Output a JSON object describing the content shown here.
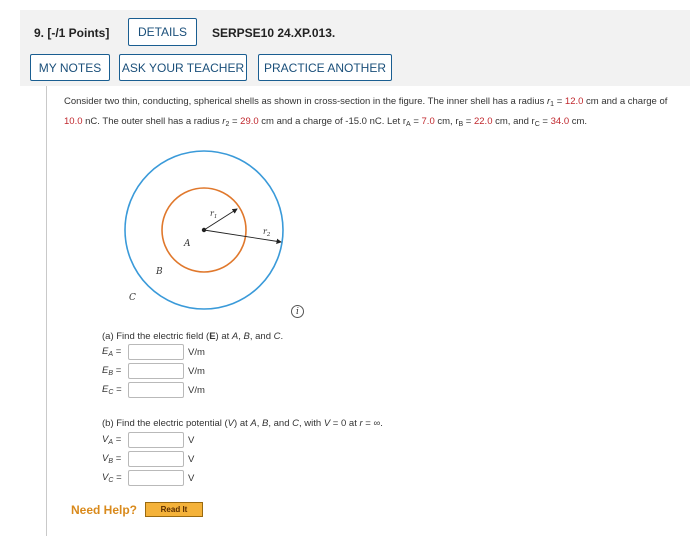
{
  "question": {
    "number_label": "9.  [-/1 Points]",
    "details_label": "DETAILS",
    "course_code": "SERPSE10 24.XP.013."
  },
  "toolbar": {
    "my_notes": "MY NOTES",
    "ask_teacher": "ASK YOUR TEACHER",
    "practice_another": "PRACTICE ANOTHER"
  },
  "problem": {
    "t1": "Consider two thin, conducting, spherical shells as shown in cross-section in the figure. The inner shell has a radius ",
    "r1_symbol": "r",
    "r1_sub": "1",
    "eq1": " = ",
    "r1_value": "12.0",
    "t2": " cm and a charge of ",
    "q1_value": "10.0",
    "t3": " nC. The outer shell has a radius ",
    "r2_symbol": "r",
    "r2_sub": "2",
    "eq2": " = ",
    "r2_value": "29.0",
    "t4": " cm and a charge of -15.0 nC. Let r",
    "rA_sub": "A",
    "eq3": " = ",
    "rA_value": "7.0",
    "t5": " cm, r",
    "rB_sub": "B",
    "eq4": " = ",
    "rB_value": "22.0",
    "t6": " cm, and r",
    "rC_sub": "C",
    "eq5": " = ",
    "rC_value": "34.0",
    "t7": " cm."
  },
  "figure": {
    "label_r1": "r",
    "label_r1_sub": "1",
    "label_r2": "r",
    "label_r2_sub": "2",
    "label_A": "A",
    "label_B": "B",
    "label_C": "C",
    "outer_color": "#3a9ad9",
    "inner_color": "#e0782c"
  },
  "part_a": {
    "prompt_1": "(a) Find the electric field (",
    "prompt_bold": "E",
    "prompt_2": ") at ",
    "pA": "A",
    "sep1": ", ",
    "pB": "B",
    "sep2": ", and ",
    "pC": "C",
    "end": ".",
    "rows": [
      {
        "label": "E",
        "sub": "A",
        "unit": "V/m"
      },
      {
        "label": "E",
        "sub": "B",
        "unit": "V/m"
      },
      {
        "label": "E",
        "sub": "C",
        "unit": "V/m"
      }
    ]
  },
  "part_b": {
    "prompt_1": "(b) Find the electric potential (",
    "prompt_v": "V",
    "prompt_2": ") at ",
    "pA": "A",
    "sep1": ", ",
    "pB": "B",
    "sep2": ", and ",
    "pC": "C",
    "prompt_3": ", with ",
    "v_sym": "V",
    "prompt_4": " = 0 at ",
    "r_sym": "r",
    "prompt_5": " = ∞.",
    "rows": [
      {
        "label": "V",
        "sub": "A",
        "unit": "V"
      },
      {
        "label": "V",
        "sub": "B",
        "unit": "V"
      },
      {
        "label": "V",
        "sub": "C",
        "unit": "V"
      }
    ]
  },
  "help": {
    "need_help": "Need Help?",
    "read_it": "Read It"
  },
  "icons": {
    "info": "info-icon"
  }
}
